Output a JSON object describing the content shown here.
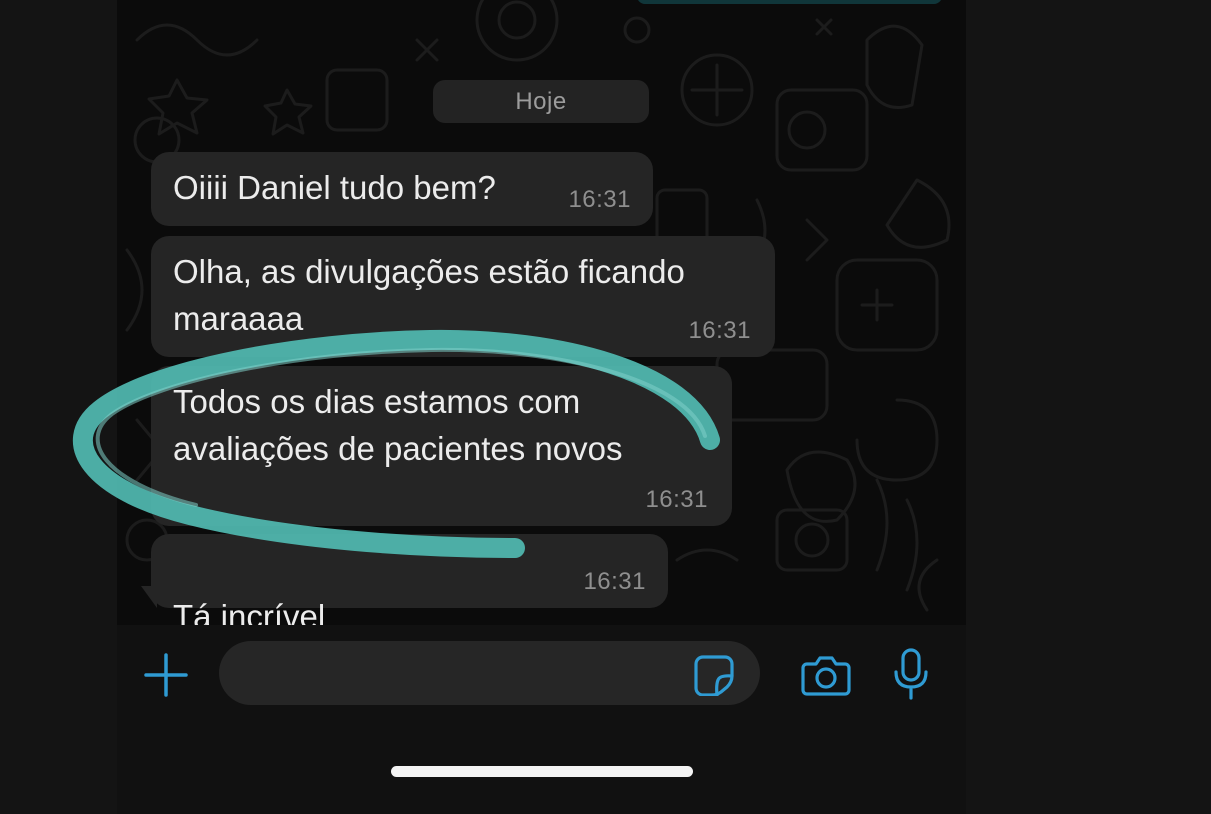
{
  "chat": {
    "date_divider": "Hoje",
    "messages": [
      {
        "text": "Oiiii Daniel tudo bem?",
        "time": "16:31"
      },
      {
        "text": "Olha, as divulgações estão ficando\nmaraaaa",
        "time": "16:31"
      },
      {
        "text": "Todos os dias estamos com\navaliações de pacientes novos",
        "time": "16:31"
      },
      {
        "text": "Tá incrível",
        "emoji": "😂😂😂🙏",
        "time": "16:31"
      }
    ]
  },
  "input_bar": {
    "message_value": "",
    "icons": [
      "plus-icon",
      "sticker-icon",
      "camera-icon",
      "microphone-icon"
    ]
  },
  "colors": {
    "accent": "#2f9bd3",
    "highlight_stroke": "#4fb5ad",
    "bubble_bg": "#252525",
    "chat_bg": "#0b0b0b"
  }
}
